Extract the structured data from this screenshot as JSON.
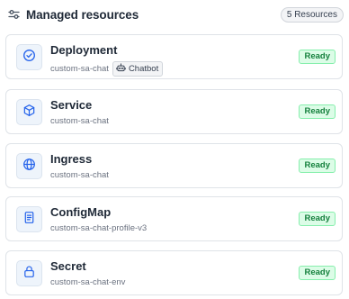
{
  "header": {
    "icon": "filter-sliders-icon",
    "title": "Managed resources",
    "count_label": "5 Resources"
  },
  "resources": [
    {
      "name": "Deployment",
      "id": "custom-sa-chat",
      "icon": "check-circle-icon",
      "tag": {
        "icon": "robot-icon",
        "label": "Chatbot"
      },
      "status": "Ready"
    },
    {
      "name": "Service",
      "id": "custom-sa-chat",
      "icon": "cube-icon",
      "status": "Ready"
    },
    {
      "name": "Ingress",
      "id": "custom-sa-chat",
      "icon": "globe-icon",
      "status": "Ready"
    },
    {
      "name": "ConfigMap",
      "id": "custom-sa-chat-profile-v3",
      "icon": "file-text-icon",
      "status": "Ready"
    },
    {
      "name": "Secret",
      "id": "custom-sa-chat-env",
      "icon": "lock-icon",
      "status": "Ready"
    }
  ],
  "colors": {
    "accent": "#2563eb",
    "ready_text": "#15803d",
    "ready_bg": "#dcfce7",
    "ready_border": "#86efac"
  }
}
